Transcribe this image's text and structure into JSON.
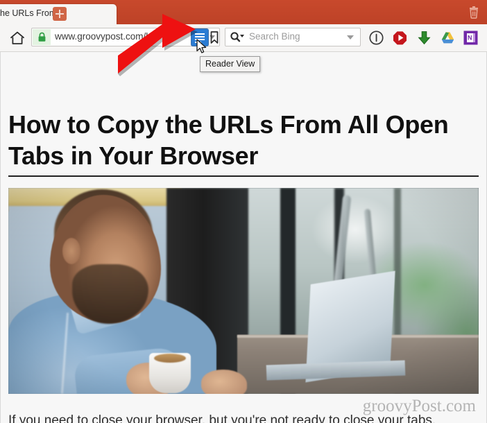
{
  "browser": {
    "tab": {
      "title_visible": "he URLs From",
      "new_tab_label": "+",
      "close_all_label": "trash"
    },
    "toolbar": {
      "home_label": "Home",
      "url": "www.groovypost.com/h",
      "lock_state": "secure",
      "reader_label": "Reader View",
      "bookmark_label": "Bookmark this page",
      "search_placeholder": "Search Bing",
      "search_engine": "Bing"
    },
    "extensions": [
      {
        "name": "info-circle-extension",
        "label": "Info"
      },
      {
        "name": "video-download-extension",
        "label": "Video Downloader"
      },
      {
        "name": "download-arrow-extension",
        "label": "Download"
      },
      {
        "name": "google-drive-extension",
        "label": "Google Drive"
      },
      {
        "name": "onenote-extension",
        "label": "OneNote"
      }
    ],
    "tooltip": {
      "text": "Reader View"
    },
    "annotation": {
      "arrow_color": "#ee1111",
      "points_to": "reader-view-button"
    }
  },
  "page": {
    "title": "How to Copy the URLs From All Open Tabs in Your Browser",
    "hero_image_alt": "Man with beard in blue shirt holding a coffee cup while working on a laptop at a wooden desk",
    "watermark": "groovyPost.com",
    "body_text": "If you need to close your browser, but you're not ready to close your tabs,"
  },
  "colors": {
    "chrome_red": "#c4472a",
    "tab_background": "#f6f5f4",
    "reader_blue": "#2b7cd3",
    "lock_green": "#2f9e44",
    "annotation_red": "#ee1111",
    "watermark_gray": "#b4b4b4"
  }
}
